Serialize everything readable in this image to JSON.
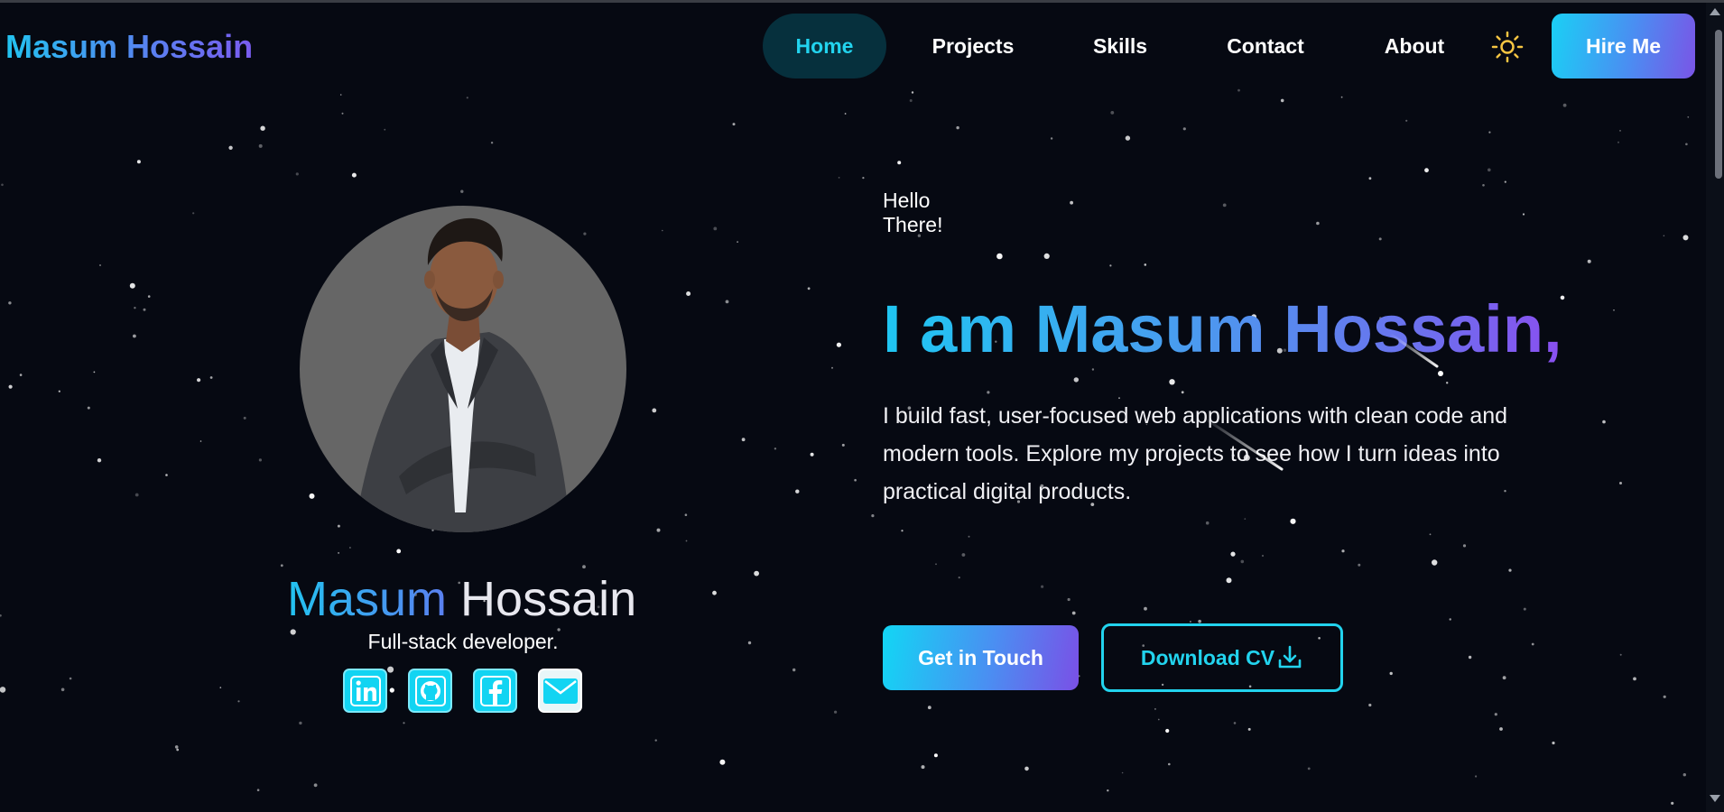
{
  "header": {
    "logo": "Masum Hossain",
    "nav": [
      "Home",
      "Projects",
      "Skills",
      "Contact",
      "About"
    ],
    "active_nav": "Home",
    "theme_toggle_icon": "sun-icon",
    "hire_label": "Hire Me"
  },
  "profile": {
    "name_first": "Masum",
    "name_last": " Hossain",
    "role": "Full-stack developer.",
    "photo": "portrait-photo",
    "socials": [
      {
        "name": "linkedin",
        "icon": "linkedin-icon"
      },
      {
        "name": "github",
        "icon": "github-icon"
      },
      {
        "name": "facebook",
        "icon": "facebook-icon"
      },
      {
        "name": "email",
        "icon": "mail-icon"
      }
    ]
  },
  "hero": {
    "greeting": "Hello There!",
    "headline": "I am Masum Hossain,",
    "bio": "I build fast, user-focused web applications with clean code and modern tools. Explore my projects to see how I turn ideas into practical digital products.",
    "cta_primary": "Get in Touch",
    "cta_secondary": "Download CV",
    "download_icon": "download-icon"
  },
  "colors": {
    "background": "#060912",
    "accent_cyan": "#22d3ee",
    "accent_purple": "#7a55e6",
    "active_nav_bg": "#06303d",
    "avatar_bg": "#666666"
  }
}
